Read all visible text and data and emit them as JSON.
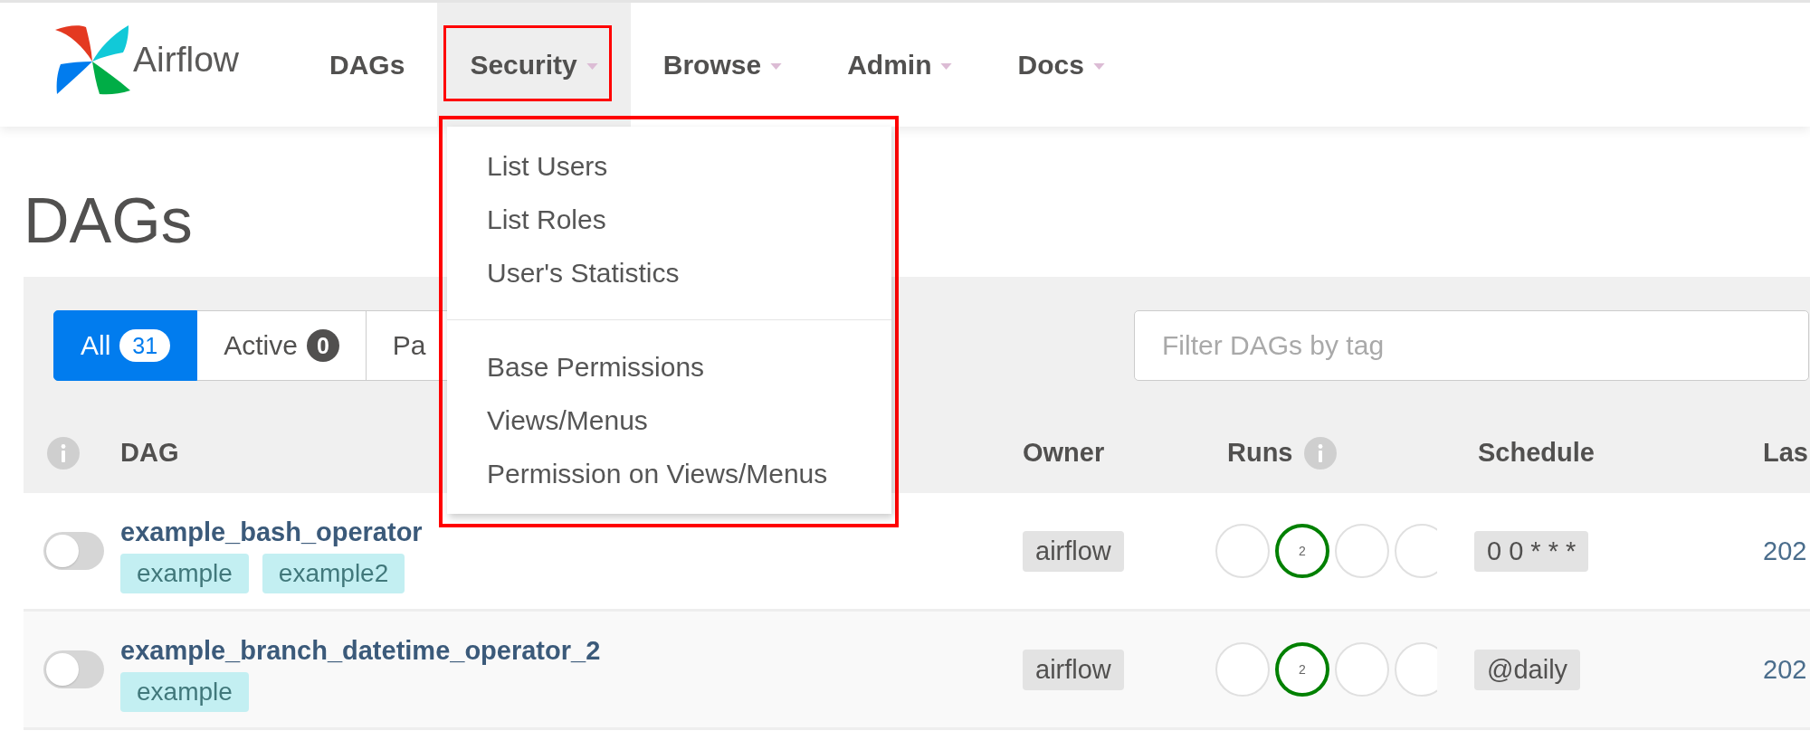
{
  "brand": {
    "name": "Airflow"
  },
  "nav": [
    {
      "label": "DAGs",
      "has_menu": false,
      "selected": false,
      "highlighted": false
    },
    {
      "label": "Security",
      "has_menu": true,
      "selected": true,
      "highlighted": true
    },
    {
      "label": "Browse",
      "has_menu": true,
      "selected": false,
      "highlighted": false
    },
    {
      "label": "Admin",
      "has_menu": true,
      "selected": false,
      "highlighted": false
    },
    {
      "label": "Docs",
      "has_menu": true,
      "selected": false,
      "highlighted": false
    }
  ],
  "dropdown": {
    "highlighted": true,
    "sections": [
      {
        "items": [
          "List Users",
          "List Roles",
          "User's Statistics"
        ]
      },
      {
        "items": [
          "Base Permissions",
          "Views/Menus",
          "Permission on Views/Menus"
        ]
      }
    ]
  },
  "page_title": "DAGs",
  "status_tabs": [
    {
      "label": "All",
      "count": "31",
      "selected": true
    },
    {
      "label": "Active",
      "count": "0",
      "selected": false
    },
    {
      "label": "Pa",
      "selected": false
    }
  ],
  "tag_filter": {
    "placeholder": "Filter DAGs by tag"
  },
  "table": {
    "columns": [
      {
        "info": true
      },
      {
        "label": "DAG",
        "info": false
      },
      {
        "label": "Owner",
        "info": false
      },
      {
        "label": "Runs",
        "info": true
      },
      {
        "label": "Schedule",
        "info": false
      },
      {
        "label": "Las",
        "info": false
      }
    ],
    "rows": [
      {
        "on": false,
        "dag_id": "example_bash_operator",
        "tags": [
          "example",
          "example2"
        ],
        "owner": "airflow",
        "runs": [
          {
            "color": "#e0e0e0"
          },
          {
            "color": "#008000",
            "count": "2"
          },
          {
            "color": "#e0e0e0"
          },
          {
            "color": "#e0e0e0"
          }
        ],
        "schedule": "0 0 * * *",
        "last_run": "202"
      },
      {
        "on": false,
        "dag_id": "example_branch_datetime_operator_2",
        "tags": [
          "example"
        ],
        "owner": "airflow",
        "runs": [
          {
            "color": "#e0e0e0"
          },
          {
            "color": "#008000",
            "count": "2"
          },
          {
            "color": "#e0e0e0"
          },
          {
            "color": "#e0e0e0"
          }
        ],
        "schedule": "@daily",
        "last_run": "202"
      }
    ]
  }
}
